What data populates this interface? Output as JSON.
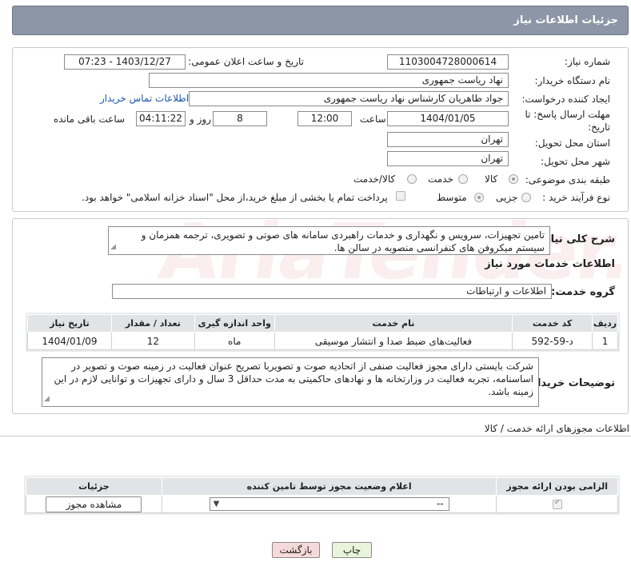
{
  "header": {
    "title": "جزئیات اطلاعات نیاز"
  },
  "form": {
    "need_number_label": "شماره نیاز:",
    "need_number": "1103004728000614",
    "announce_label": "تاریخ و ساعت اعلان عمومی:",
    "announce_value": "1403/12/27 - 07:23",
    "buyer_org_label": "نام دستگاه خریدار:",
    "buyer_org": "نهاد ریاست جمهوری",
    "creator_label": "ایجاد کننده درخواست:",
    "creator": "جواد طاهریان کارشناس نهاد ریاست جمهوری",
    "contact_link": "اطلاعات تماس خریدار",
    "deadline_label_1": "مهلت ارسال پاسخ: تا",
    "deadline_label_2": "تاریخ:",
    "deadline_date": "1404/01/05",
    "time_label": "ساعت",
    "deadline_time": "12:00",
    "days_value": "8",
    "days_label": "روز و",
    "remaining_time": "04:11:22",
    "remaining_label": "ساعت باقی مانده",
    "province_label": "استان محل تحویل:",
    "province": "تهران",
    "city_label": "شهر محل تحویل:",
    "city": "تهران",
    "category_label": "طبقه بندی موضوعی:",
    "category_options": [
      "کالا",
      "خدمت",
      "کالا/خدمت"
    ],
    "process_label": "نوع فرآیند خرید :",
    "process_options": [
      "جزیی",
      "متوسط"
    ],
    "payment_note": "پرداخت تمام یا بخشی از مبلغ خرید،از محل \"اسناد خزانه اسلامی\" خواهد بود."
  },
  "summary": {
    "label": "شرح کلی نیاز:",
    "text": "تامین تجهیزات، سرویس و نگهداری و خدمات راهبردی سامانه های صوتی و تصویری، ترجمه همزمان و سیستم میکروفن های کنفرانسی منصوبه در سالن ها."
  },
  "services": {
    "section_title": "اطلاعات خدمات مورد نیاز",
    "group_label": "گروه خدمت:",
    "group_value": "اطلاعات و ارتباطات",
    "columns": [
      "ردیف",
      "کد خدمت",
      "نام خدمت",
      "واحد اندازه گیری",
      "تعداد / مقدار",
      "تاریخ نیاز"
    ],
    "rows": [
      [
        "1",
        "د-59-592",
        "فعالیت‌های ضبط صدا و انتشار موسیقی",
        "ماه",
        "12",
        "1404/01/09"
      ]
    ]
  },
  "buyer_notes": {
    "label": "توضیحات خریدار:",
    "text": "شرکت بایستی دارای مجوز فعالیت صنفی از اتحادیه صوت و تصویربا تصریح عنوان فعالیت در زمینه صوت و تصویر در اساسنامه، تجربه فعالیت در وزارتخانه ها و نهادهای حاکمیتی به مدت حداقل 3 سال و دارای تجهیزات و توانایی لازم در این زمینه باشد."
  },
  "permits": {
    "section_title": "اطلاعات مجوزهای ارائه خدمت / کالا",
    "columns": [
      "الزامی بودن ارائه مجوز",
      "اعلام وضعیت مجوز توسط تامین کننده",
      "جزئیات"
    ],
    "select_value": "--",
    "view_button": "مشاهده مجوز"
  },
  "actions": {
    "print": "چاپ",
    "back": "بازگشت"
  },
  "watermark": "AriaTender.neT",
  "colors": {
    "header_bg": "#8d96a6",
    "link": "#1a56b0",
    "back_btn": "#f6dada",
    "print_btn": "#e8f4dc"
  }
}
